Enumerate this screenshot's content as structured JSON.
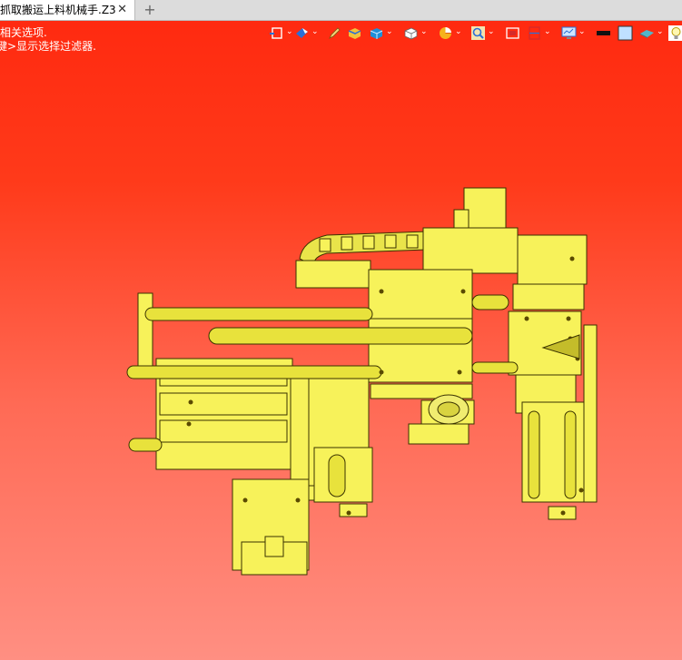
{
  "tab": {
    "title": "抓取搬运上料机械手.Z3",
    "close_glyph": "✕",
    "new_tab_glyph": "+"
  },
  "viewport": {
    "hint_lines": [
      "相关选项.",
      "显示选择过滤器."
    ],
    "hint_prefix": "键>",
    "background_top": "#ff2a10",
    "background_bottom": "#ff8f82",
    "model_color": "#f7f25a",
    "model_outline": "#3a3200"
  },
  "toolbar": {
    "dropdown_glyph": "⌄",
    "items": [
      {
        "icon": "view-frame-icon",
        "dropdown": true
      },
      {
        "icon": "render-mode-icon",
        "dropdown": true
      },
      {
        "icon": "pencil-icon",
        "dropdown": false
      },
      {
        "icon": "shaded-box-icon",
        "dropdown": false
      },
      {
        "icon": "solid-cube-icon",
        "dropdown": true
      },
      {
        "icon": "wire-cube-icon",
        "dropdown": true
      },
      {
        "icon": "pie-section-icon",
        "dropdown": true
      },
      {
        "icon": "zoom-magnifier-icon",
        "dropdown": true
      },
      {
        "icon": "camera-icon",
        "dropdown": false
      },
      {
        "icon": "clip-plane-icon",
        "dropdown": true
      },
      {
        "icon": "display-monitor-icon",
        "dropdown": true
      },
      {
        "icon": "line-color-icon",
        "dropdown": false
      },
      {
        "icon": "fill-color-icon",
        "dropdown": false
      },
      {
        "icon": "material-icon",
        "dropdown": true
      },
      {
        "icon": "light-bulb-icon",
        "dropdown": false
      }
    ]
  }
}
